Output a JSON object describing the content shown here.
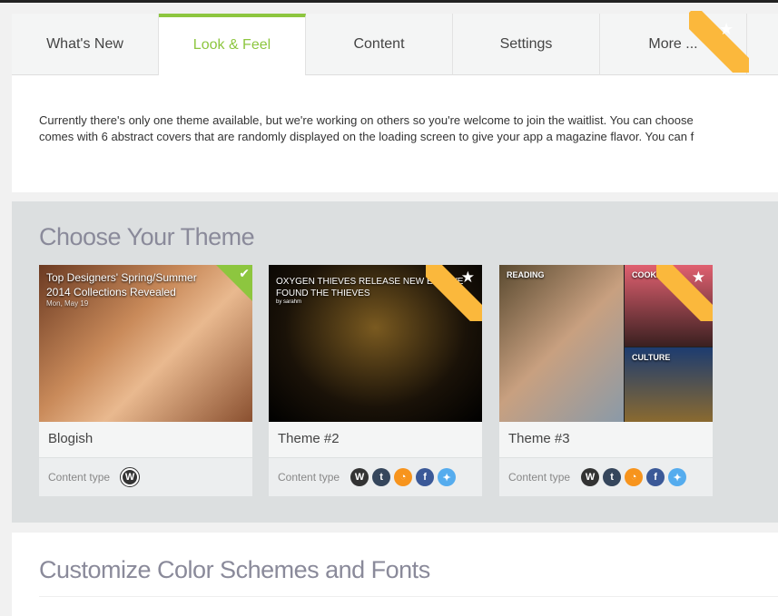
{
  "tabs": [
    {
      "label": "What's New"
    },
    {
      "label": "Look & Feel"
    },
    {
      "label": "Content"
    },
    {
      "label": "Settings"
    },
    {
      "label": "More ..."
    }
  ],
  "intro": {
    "line1": "Currently there's only one theme available, but we're working on others so you're welcome to join the waitlist. You can choose",
    "line2": "comes with 6 abstract covers that are randomly displayed on the loading screen to give your app a magazine flavor. You can f"
  },
  "themes_title": "Choose Your Theme",
  "content_type_label": "Content type",
  "cards": [
    {
      "name": "Blogish",
      "headline": "Top Designers' Spring/Summer 2014 Collections Revealed",
      "date": "Mon, May 19",
      "selected": true
    },
    {
      "name": "Theme #2",
      "headline": "OXYGEN THIEVES RELEASE NEW EP – WE FOUND THE THIEVES",
      "byline": "by sarahm",
      "premium": true
    },
    {
      "name": "Theme #3",
      "tiles": [
        "READING",
        "COOKING",
        "CULTURE"
      ],
      "premium": true
    }
  ],
  "customize_title": "Customize Color Schemes and Fonts",
  "colors": {
    "accent": "#8dc63f",
    "ribbon": "#fbb83c"
  }
}
